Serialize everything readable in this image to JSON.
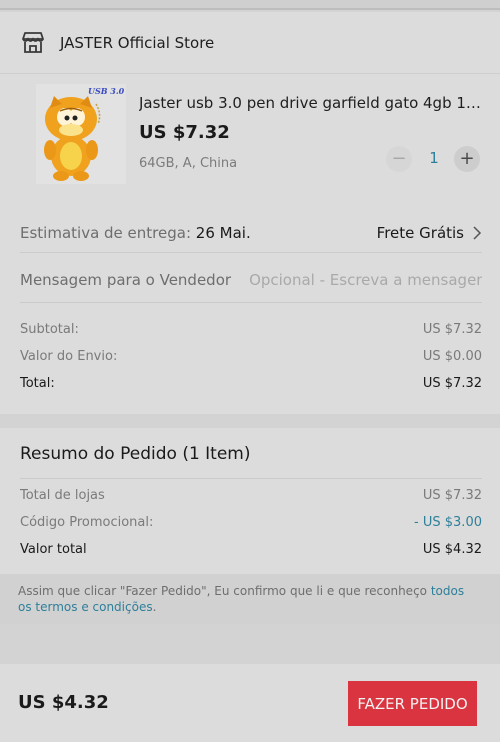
{
  "store": {
    "name": "JASTER Official Store"
  },
  "product": {
    "thumb_badge": "USB 3.0",
    "title": "Jaster usb 3.0 pen drive garfield gato 4gb 16...",
    "price": "US $7.32",
    "variant": "64GB, A, China",
    "quantity": "1",
    "minus_label": "−",
    "plus_label": "+"
  },
  "delivery": {
    "label": "Estimativa de entrega:",
    "date": "26 Mai.",
    "shipping": "Frete Grátis"
  },
  "message": {
    "label": "Mensagem para o Vendedor",
    "placeholder": "Opcional - Escreva a mensagem ao vendedor"
  },
  "store_totals": {
    "subtotal_label": "Subtotal:",
    "subtotal_value": "US $7.32",
    "shipping_label": "Valor do Envio:",
    "shipping_value": "US $0.00",
    "total_label": "Total:",
    "total_value": "US $7.32"
  },
  "summary": {
    "title": "Resumo do Pedido (1 Item)",
    "stores_label": "Total de lojas",
    "stores_value": "US $7.32",
    "promo_label": "Código Promocional:",
    "promo_value": "- US $3.00",
    "total_label": "Valor total",
    "total_value": "US $4.32"
  },
  "note": {
    "text": "Assim que clicar \"Fazer Pedido\", Eu confirmo que li e que reconheço ",
    "link": "todos os termos e condições",
    "end": "."
  },
  "footer": {
    "grand_total": "US $4.32",
    "place_order": "FAZER PEDIDO"
  },
  "colors": {
    "accent": "#2e7f9a",
    "button": "#d9343f"
  },
  "icons": {
    "store": "store-icon",
    "chevron": "chevron-right-icon"
  }
}
